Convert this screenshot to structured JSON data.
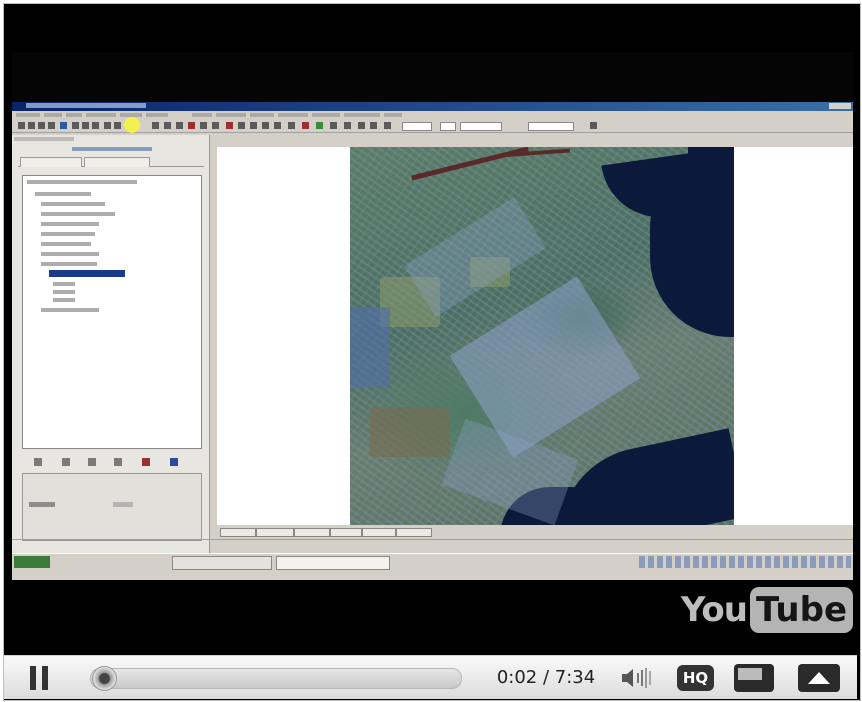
{
  "window": {
    "title": "",
    "menus": []
  },
  "sidepanel": {
    "title": "",
    "subtitle": "",
    "layers": [],
    "checkbox_label": ""
  },
  "player": {
    "logo_you": "You",
    "logo_tube": "Tube",
    "progress_fraction": 0.0045,
    "time": "0:02 / 7:34",
    "hq_label": "HQ",
    "icons": [
      "pause-icon",
      "volume-icon",
      "hq-icon",
      "window-size-icon",
      "fullscreen-icon"
    ]
  },
  "colors": {
    "player_bar": "#dcdcdc",
    "hq_bg": "#333333",
    "logo_grey": "#b4b4b4"
  }
}
